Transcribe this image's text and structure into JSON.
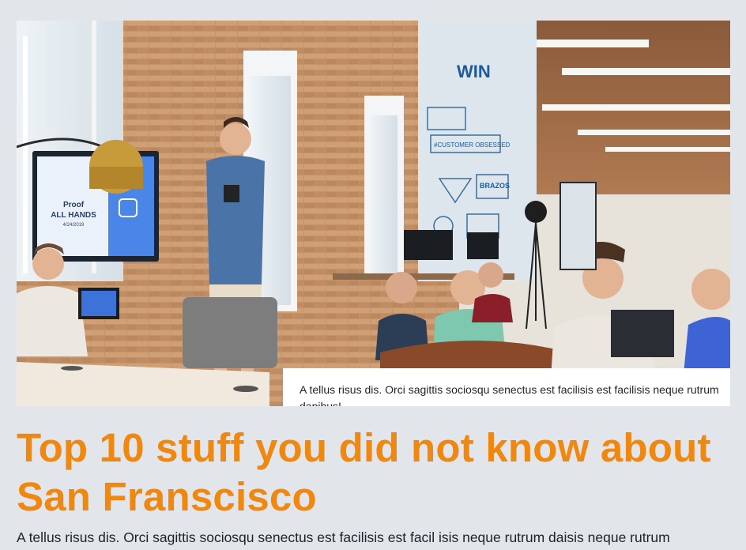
{
  "hero": {
    "image_label": "office-presentation-photo",
    "screen_text": {
      "line1": "Proof",
      "line2": "ALL HANDS",
      "line3": "4/24/2019"
    },
    "wall_art": {
      "win": "WIN",
      "customer": "#CUSTOMER OBSESSED",
      "brazos": "BRAZOS"
    },
    "caption": "A tellus risus dis. Orci sagittis sociosqu senectus est facilisis est facilisis neque rutrum dapibus!"
  },
  "article": {
    "title": "Top 10 stuff you did not know about San Franscisco",
    "lede": "A tellus risus dis. Orci sagittis sociosqu senectus est facilisis est facil isis neque rutrum daisis neque rutrum"
  },
  "colors": {
    "accent": "#f0870f",
    "background": "#e2e5e9",
    "text": "#1f2329"
  }
}
